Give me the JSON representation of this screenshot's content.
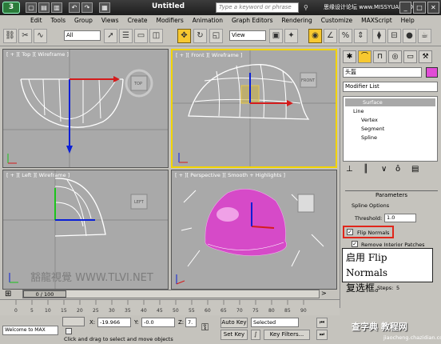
{
  "app": {
    "title": "Untitled",
    "search_placeholder": "Type a keyword or phrase",
    "site_watermark": "思缘设计论坛 www.MISSYUAN.COM"
  },
  "menu": [
    "Edit",
    "Tools",
    "Group",
    "Views",
    "Create",
    "Modifiers",
    "Animation",
    "Graph Editors",
    "Rendering",
    "Customize",
    "MAXScript",
    "Help"
  ],
  "toolbar": {
    "selection_filter": "All",
    "ref_coord": "View"
  },
  "viewports": {
    "top": "[ + ][ Top ][ Wireframe ]",
    "front": "[ + ][ Front ][ Wireframe ]",
    "left": "[ + ][ Left ][ Wireframe ]",
    "persp": "[ + ][ Perspective ][ Smooth + Highlights ]",
    "cube_top": "TOP",
    "cube_front": "FRONT",
    "cube_left": "LEFT",
    "watermark": "豁龍視覺 WWW.TLVI.NET"
  },
  "command": {
    "object_name": "头盔",
    "modifier_list": "Modifier List",
    "stack": [
      "Surface",
      "Line",
      "Vertex",
      "Segment",
      "Spline"
    ],
    "rollout": "Parameters",
    "spline_options": "Spline Options",
    "threshold_label": "Threshold:",
    "threshold_value": "1.0",
    "flip_normals": "Flip Normals",
    "remove_patches": "Remove Interior Patches",
    "steps_label": "Steps:",
    "steps_value": "5"
  },
  "callout": {
    "line1": "启用 Flip Normals",
    "line2": "复选框。"
  },
  "timeline": {
    "frame": "0 / 100",
    "ticks": [
      "0",
      "5",
      "10",
      "15",
      "20",
      "25",
      "30",
      "35",
      "40",
      "45",
      "50",
      "55",
      "60",
      "65",
      "70",
      "75",
      "80",
      "85",
      "90"
    ]
  },
  "status": {
    "welcome": "Welcome to MAX",
    "prompt": "Click and drag to select and move objects",
    "x_label": "X:",
    "x_value": "-19.966",
    "y_label": "Y:",
    "y_value": "-0.0",
    "z_label": "Z:",
    "z_value": "7.",
    "autokey": "Auto Key",
    "setkey": "Set Key",
    "selected": "Selected",
    "keyfilters": "Key Filters...",
    "brand_watermark": "查字典 教程网",
    "brand_url": "jiaocheng.chazidian.com"
  }
}
